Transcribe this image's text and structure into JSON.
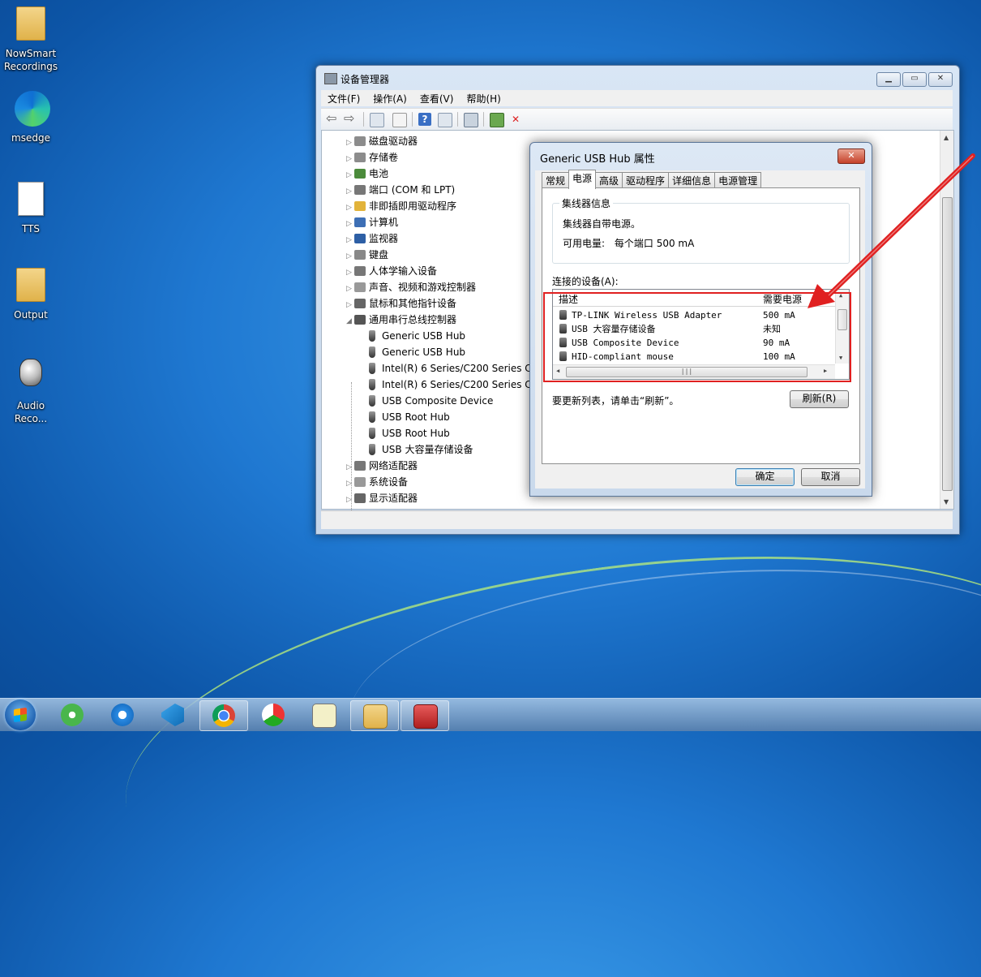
{
  "desktop": {
    "icons": [
      {
        "label": "NowSmart Recordings"
      },
      {
        "label": "msedge"
      },
      {
        "label": "TTS"
      },
      {
        "label": "Output"
      },
      {
        "label": "Audio Reco..."
      }
    ]
  },
  "device_manager": {
    "title": "设备管理器",
    "menu": [
      "文件(F)",
      "操作(A)",
      "查看(V)",
      "帮助(H)"
    ],
    "tree": [
      {
        "label": "磁盘驱动器",
        "level": 0,
        "expanded": false
      },
      {
        "label": "存储卷",
        "level": 0,
        "expanded": false
      },
      {
        "label": "电池",
        "level": 0,
        "expanded": false
      },
      {
        "label": "端口 (COM 和 LPT)",
        "level": 0,
        "expanded": false
      },
      {
        "label": "非即插即用驱动程序",
        "level": 0,
        "expanded": false
      },
      {
        "label": "计算机",
        "level": 0,
        "expanded": false
      },
      {
        "label": "监视器",
        "level": 0,
        "expanded": false
      },
      {
        "label": "键盘",
        "level": 0,
        "expanded": false
      },
      {
        "label": "人体学输入设备",
        "level": 0,
        "expanded": false
      },
      {
        "label": "声音、视频和游戏控制器",
        "level": 0,
        "expanded": false
      },
      {
        "label": "鼠标和其他指针设备",
        "level": 0,
        "expanded": false
      },
      {
        "label": "通用串行总线控制器",
        "level": 0,
        "expanded": true
      },
      {
        "label": "Generic USB Hub",
        "level": 1
      },
      {
        "label": "Generic USB Hub",
        "level": 1
      },
      {
        "label": "Intel(R) 6 Series/C200 Series C",
        "level": 1
      },
      {
        "label": "Intel(R) 6 Series/C200 Series C",
        "level": 1
      },
      {
        "label": "USB Composite Device",
        "level": 1
      },
      {
        "label": "USB Root Hub",
        "level": 1
      },
      {
        "label": "USB Root Hub",
        "level": 1
      },
      {
        "label": "USB 大容量存储设备",
        "level": 1
      },
      {
        "label": "网络适配器",
        "level": 0,
        "expanded": false
      },
      {
        "label": "系统设备",
        "level": 0,
        "expanded": false
      },
      {
        "label": "显示适配器",
        "level": 0,
        "expanded": false
      }
    ]
  },
  "dialog": {
    "title": "Generic USB Hub 属性",
    "tabs": [
      "常规",
      "电源",
      "高级",
      "驱动程序",
      "详细信息",
      "电源管理"
    ],
    "active_tab": "电源",
    "hub_group_label": "集线器信息",
    "hub_self_powered": "集线器自带电源。",
    "available_power_label": "可用电量:",
    "available_power_value": "每个端口 500 mA",
    "connected_label": "连接的设备(A):",
    "columns": [
      "描述",
      "需要电源"
    ],
    "devices": [
      {
        "name": "TP-LINK Wireless USB Adapter",
        "power": "500 mA"
      },
      {
        "name": "USB 大容量存储设备",
        "power": "未知"
      },
      {
        "name": "USB Composite Device",
        "power": "90 mA"
      },
      {
        "name": "HID-compliant mouse",
        "power": "100 mA"
      }
    ],
    "hint": "要更新列表，请单击“刷新”。",
    "refresh_label": "刷新(R)",
    "ok_label": "确定",
    "cancel_label": "取消"
  },
  "taskbar": {
    "apps": [
      "wechat-icon",
      "ie-icon",
      "vscode-icon",
      "chrome-icon",
      "app-icon",
      "notepad-icon",
      "explorer-icon",
      "toolbox-icon"
    ]
  },
  "colors": {
    "annotation": "#e02020",
    "desktop_bg": "#1f78d1"
  }
}
